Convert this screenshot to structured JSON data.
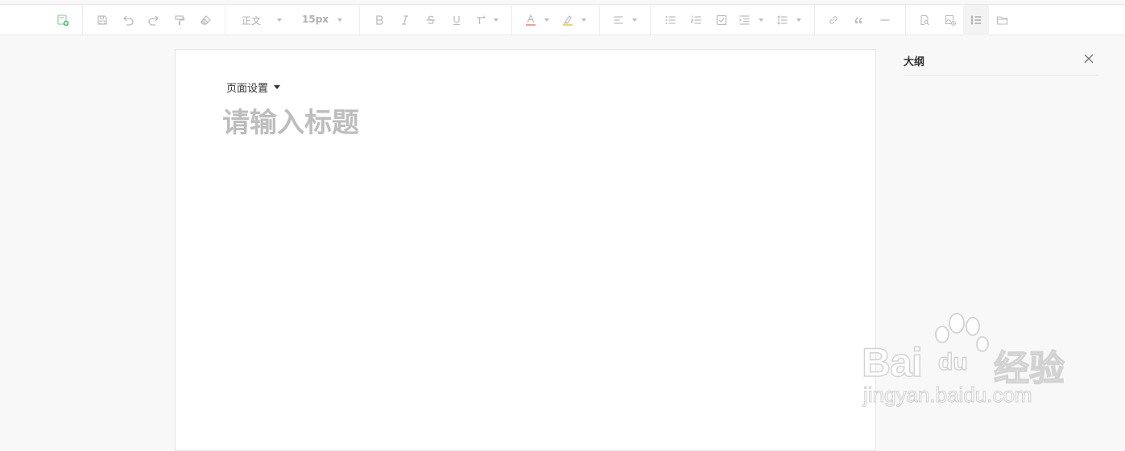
{
  "toolbar": {
    "paragraph_style": "正文",
    "font_size": "15px"
  },
  "document": {
    "page_settings_label": "页面设置",
    "title_placeholder": "请输入标题"
  },
  "outline": {
    "title": "大纲"
  },
  "watermark": {
    "brand_left": "Bai",
    "brand_mid": "du",
    "brand_right": "经验",
    "url": "jingyan.baidu.com"
  },
  "colors": {
    "new_doc_icon": "#58c27d",
    "font_color_bar": "#e85b5b",
    "highlight_bar": "#e8c53a"
  }
}
